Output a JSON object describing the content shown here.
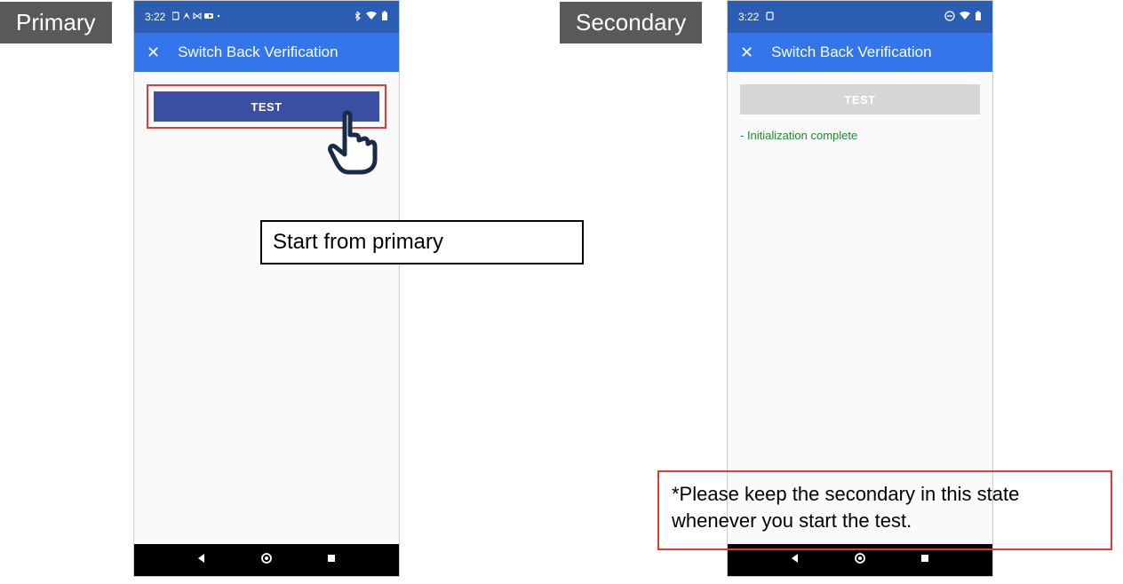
{
  "labels": {
    "primary": "Primary",
    "secondary": "Secondary"
  },
  "status_bar": {
    "time": "3:22",
    "icons_primary_left": "⌵ ⋈ ⟨ ▸ ·",
    "icons_primary_right": "✱ ▾ ▮",
    "icons_secondary_left": "⌵",
    "icons_secondary_right": "⊖ ▾ ▮"
  },
  "app_bar": {
    "close": "✕",
    "title": "Switch Back Verification"
  },
  "buttons": {
    "test": "TEST"
  },
  "messages": {
    "init_complete": "- Initialization complete"
  },
  "callouts": {
    "start": "Start from primary",
    "keep_state": "*Please keep the secondary in this state whenever you start the test."
  },
  "nav": {
    "back": "◀",
    "home": "●",
    "recent": "■"
  }
}
